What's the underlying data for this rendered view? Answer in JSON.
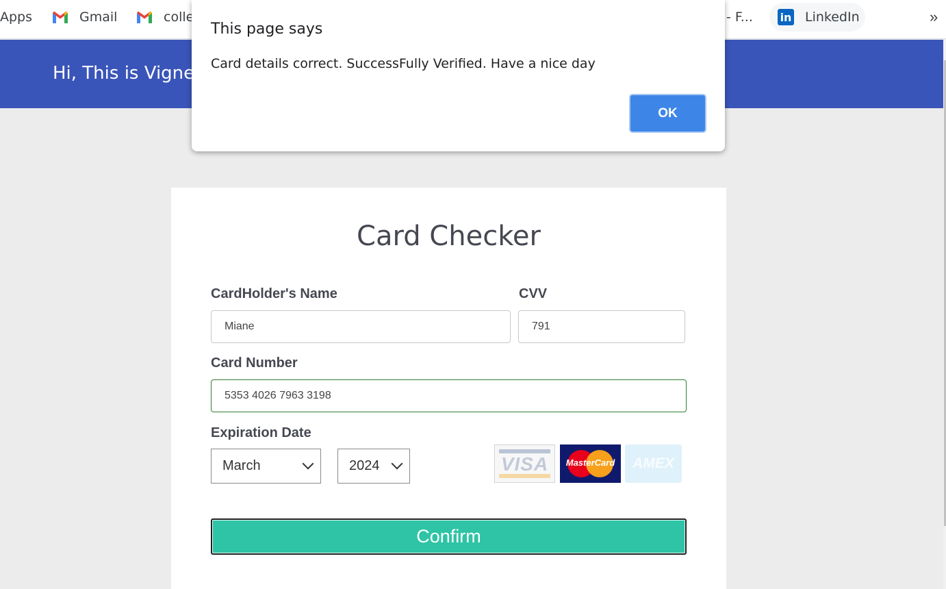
{
  "bookmarks": {
    "items": [
      {
        "label": "Apps"
      },
      {
        "label": "Gmail",
        "icon": "gmail-icon"
      },
      {
        "label": "colle",
        "icon": "gmail-icon"
      },
      {
        "label": "- F..."
      },
      {
        "label": "LinkedIn",
        "icon": "linkedin-icon"
      }
    ],
    "overflow": "»"
  },
  "header": {
    "greeting": "Hi, This is Vignes"
  },
  "card": {
    "title": "Card Checker",
    "name_label": "CardHolder's Name",
    "name_value": "Miane",
    "cvv_label": "CVV",
    "cvv_value": "791",
    "number_label": "Card Number",
    "number_value": "5353 4026 7963 3198",
    "expiry_label": "Expiration Date",
    "month_value": "March",
    "year_value": "2024",
    "logos": {
      "visa": "VISA",
      "mastercard": "MasterCard",
      "amex": "AMEX"
    },
    "confirm_label": "Confirm"
  },
  "dialog": {
    "title": "This page says",
    "message": "Card details correct. SuccessFully Verified. Have a nice day",
    "ok_label": "OK"
  },
  "colors": {
    "header": "#3a55b9",
    "confirm": "#2ec4a5",
    "ok": "#3d86e8"
  }
}
